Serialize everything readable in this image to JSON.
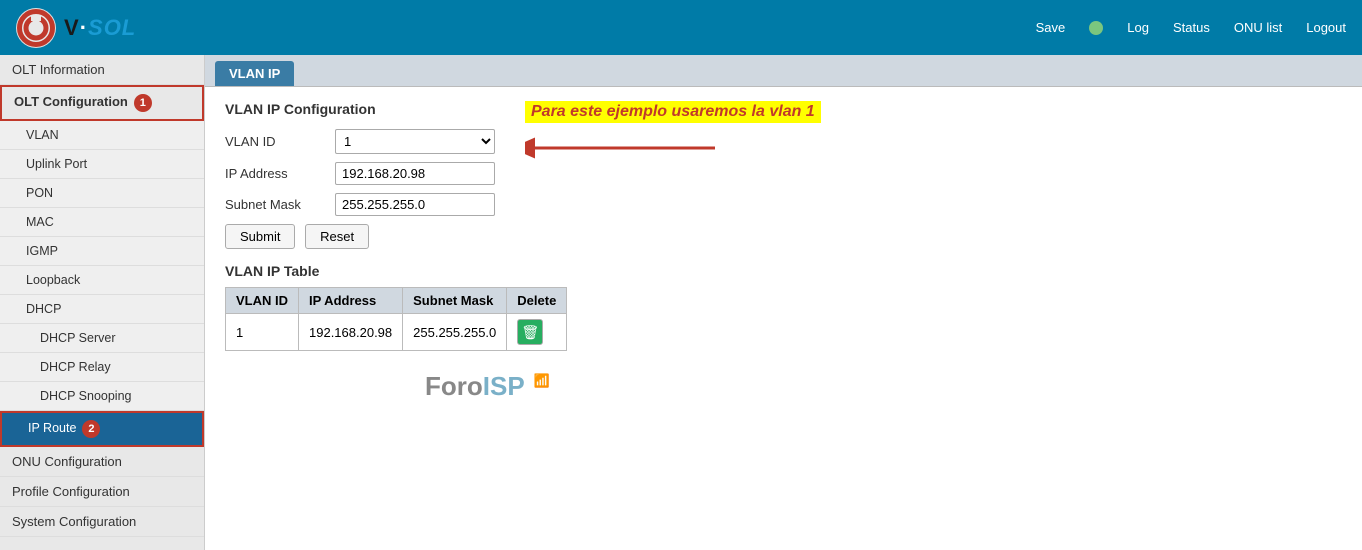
{
  "header": {
    "logo_text": "V·SOL",
    "save_label": "Save",
    "status_dot_color": "#7bc67e",
    "nav_items": [
      "Log",
      "Status",
      "ONU list",
      "Logout"
    ]
  },
  "sidebar": {
    "items": [
      {
        "id": "olt-information",
        "label": "OLT Information",
        "level": 0,
        "active": false,
        "badge": null
      },
      {
        "id": "olt-configuration",
        "label": "OLT Configuration",
        "level": 0,
        "active_parent": true,
        "badge": "1"
      },
      {
        "id": "vlan",
        "label": "VLAN",
        "level": 1,
        "active": false,
        "badge": null
      },
      {
        "id": "uplink-port",
        "label": "Uplink Port",
        "level": 1,
        "active": false,
        "badge": null
      },
      {
        "id": "pon",
        "label": "PON",
        "level": 1,
        "active": false,
        "badge": null
      },
      {
        "id": "mac",
        "label": "MAC",
        "level": 1,
        "active": false,
        "badge": null
      },
      {
        "id": "igmp",
        "label": "IGMP",
        "level": 1,
        "active": false,
        "badge": null
      },
      {
        "id": "loopback",
        "label": "Loopback",
        "level": 1,
        "active": false,
        "badge": null
      },
      {
        "id": "dhcp",
        "label": "DHCP",
        "level": 1,
        "active": false,
        "badge": null
      },
      {
        "id": "dhcp-server",
        "label": "DHCP Server",
        "level": 2,
        "active": false,
        "badge": null
      },
      {
        "id": "dhcp-relay",
        "label": "DHCP Relay",
        "level": 2,
        "active": false,
        "badge": null
      },
      {
        "id": "dhcp-snooping",
        "label": "DHCP Snooping",
        "level": 2,
        "active": false,
        "badge": null
      },
      {
        "id": "ip-route",
        "label": "IP Route",
        "level": 1,
        "active": true,
        "badge": "2"
      },
      {
        "id": "onu-configuration",
        "label": "ONU Configuration",
        "level": 0,
        "active": false,
        "badge": null
      },
      {
        "id": "profile-configuration",
        "label": "Profile Configuration",
        "level": 0,
        "active": false,
        "badge": null
      },
      {
        "id": "system-configuration",
        "label": "System Configuration",
        "level": 0,
        "active": false,
        "badge": null
      }
    ]
  },
  "tab": "VLAN IP",
  "content": {
    "section_title": "VLAN IP Configuration",
    "annotation": "Para este ejemplo usaremos la vlan 1",
    "fields": {
      "vlan_id_label": "VLAN ID",
      "vlan_id_value": "1",
      "ip_address_label": "IP Address",
      "ip_address_value": "192.168.20.98",
      "subnet_mask_label": "Subnet Mask",
      "subnet_mask_value": "255.255.255.0"
    },
    "buttons": {
      "submit": "Submit",
      "reset": "Reset"
    },
    "table_title": "VLAN IP Table",
    "table": {
      "headers": [
        "VLAN ID",
        "IP Address",
        "Subnet Mask",
        "Delete"
      ],
      "rows": [
        {
          "vlan_id": "1",
          "ip_address": "192.168.20.98",
          "subnet_mask": "255.255.255.0"
        }
      ]
    }
  },
  "watermark": {
    "text_fore": "Foro",
    "text_back": "ISP"
  }
}
